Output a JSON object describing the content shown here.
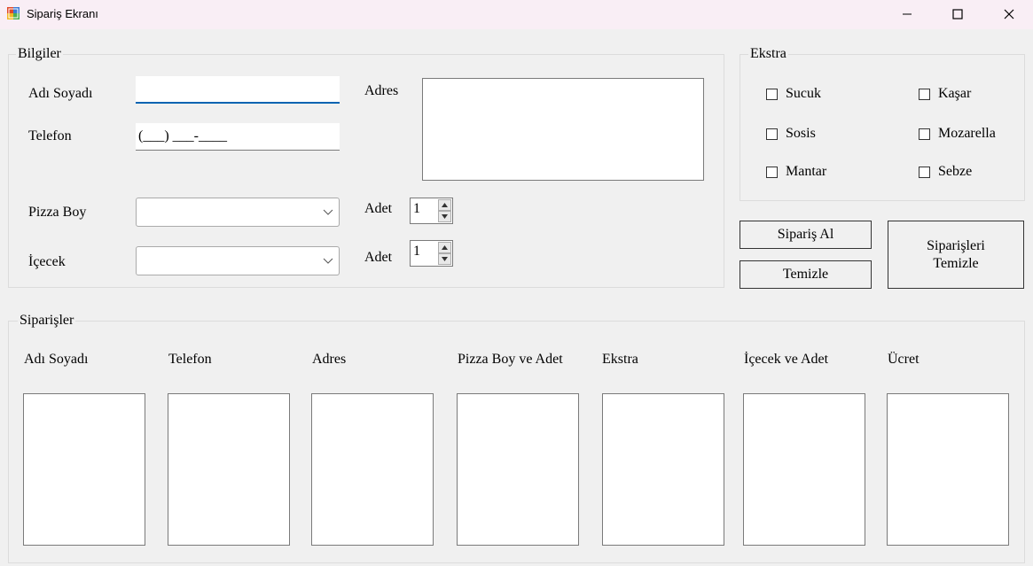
{
  "window": {
    "title": "Sipariş Ekranı"
  },
  "bilgiler": {
    "title": "Bilgiler",
    "name_label": "Adı Soyadı",
    "name_value": "",
    "phone_label": "Telefon",
    "phone_mask": "(___) ___-____",
    "address_label": "Adres",
    "address_value": "",
    "pizza_label": "Pizza Boy",
    "pizza_selected": "",
    "drink_label": "İçecek",
    "drink_selected": "",
    "pizza_qty_label": "Adet",
    "pizza_qty": "1",
    "drink_qty_label": "Adet",
    "drink_qty": "1"
  },
  "ekstra": {
    "title": "Ekstra",
    "items": [
      "Sucuk",
      "Kaşar",
      "Sosis",
      "Mozarella",
      "Mantar",
      "Sebze"
    ]
  },
  "buttons": {
    "order": "Sipariş Al",
    "clear": "Temizle",
    "clear_orders": "Siparişleri Temizle"
  },
  "siparisler": {
    "title": "Siparişler",
    "columns": [
      "Adı Soyadı",
      "Telefon",
      "Adres",
      "Pizza Boy ve Adet",
      "Ekstra",
      "İçecek ve Adet",
      "Ücret"
    ]
  },
  "colors": {
    "accent": "#0063b1",
    "titlebar": "#f9eef5",
    "window_bg": "#f0f0f0"
  }
}
